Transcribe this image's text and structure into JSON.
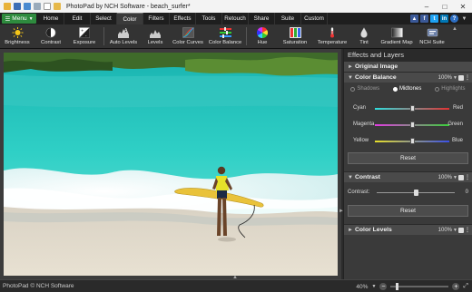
{
  "window": {
    "title": "PhotoPad by NCH Software - beach_surfer*",
    "controls": [
      "minimize",
      "maximize",
      "close"
    ]
  },
  "menu_button": "Menu",
  "tabs": [
    {
      "label": "Home",
      "active": false
    },
    {
      "label": "Edit",
      "active": false
    },
    {
      "label": "Select",
      "active": false
    },
    {
      "label": "Color",
      "active": true
    },
    {
      "label": "Filters",
      "active": false
    },
    {
      "label": "Effects",
      "active": false
    },
    {
      "label": "Tools",
      "active": false
    },
    {
      "label": "Retouch",
      "active": false
    },
    {
      "label": "Share",
      "active": false
    },
    {
      "label": "Suite",
      "active": false
    },
    {
      "label": "Custom",
      "active": false
    }
  ],
  "social_icons": [
    "thumbs-up",
    "facebook",
    "twitter",
    "linkedin",
    "help"
  ],
  "toolbar": [
    {
      "label": "Brightness",
      "icon": "sun-icon"
    },
    {
      "label": "Contrast",
      "icon": "contrast-icon"
    },
    {
      "label": "Exposure",
      "icon": "exposure-icon"
    },
    {
      "label": "Auto Levels",
      "icon": "auto-levels-icon"
    },
    {
      "label": "Levels",
      "icon": "levels-icon"
    },
    {
      "label": "Color Curves",
      "icon": "curves-icon"
    },
    {
      "label": "Color Balance",
      "icon": "color-balance-icon"
    },
    {
      "label": "Hue",
      "icon": "hue-wheel-icon"
    },
    {
      "label": "Saturation",
      "icon": "saturation-icon"
    },
    {
      "label": "Temperature",
      "icon": "thermometer-icon"
    },
    {
      "label": "Tint",
      "icon": "tint-drop-icon"
    },
    {
      "label": "Gradient Map",
      "icon": "gradient-map-icon"
    },
    {
      "label": "NCH Suite",
      "icon": "nch-suite-icon"
    }
  ],
  "panel": {
    "title": "Effects and Layers",
    "original_image": "Original Image",
    "color_balance": {
      "label": "Color Balance",
      "opacity": "100%",
      "tonal_ranges": [
        {
          "label": "Shadows",
          "selected": false
        },
        {
          "label": "Midtones",
          "selected": true
        },
        {
          "label": "Highlights",
          "selected": false
        }
      ],
      "sliders": [
        {
          "left": "Cyan",
          "right": "Red",
          "value": 0.5
        },
        {
          "left": "Magenta",
          "right": "Green",
          "value": 0.5
        },
        {
          "left": "Yellow",
          "right": "Blue",
          "value": 0.5
        }
      ],
      "reset": "Reset"
    },
    "contrast": {
      "label": "Contrast",
      "opacity": "100%",
      "field_label": "Contrast:",
      "value": "0",
      "level": 0.5,
      "reset": "Reset"
    },
    "color_levels": {
      "label": "Color Levels",
      "opacity": "100%"
    }
  },
  "status": {
    "copyright": "PhotoPad © NCH Software",
    "zoom": "40%",
    "zoom_level": 0.09
  }
}
